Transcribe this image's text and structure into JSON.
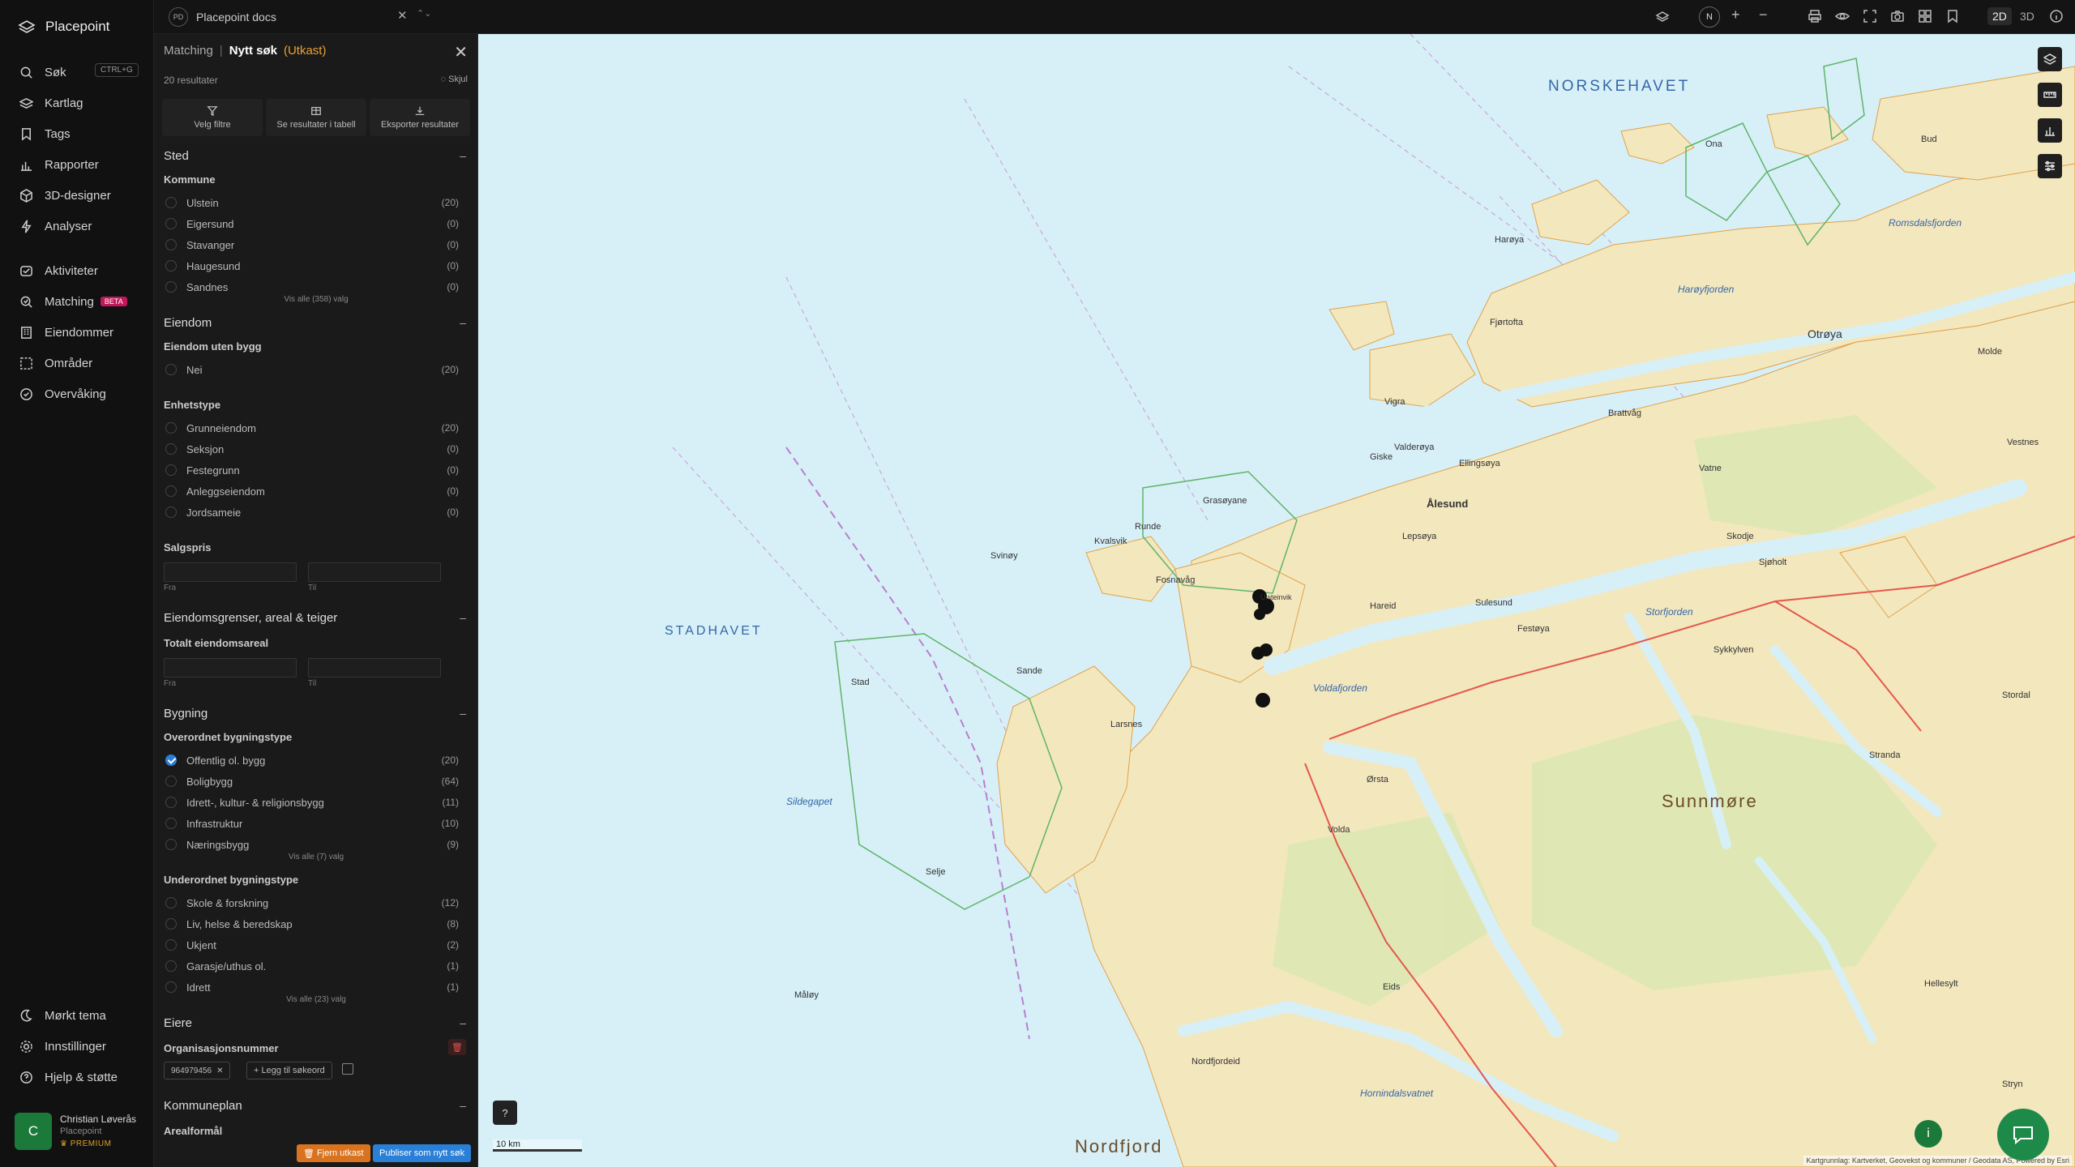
{
  "app": {
    "name": "Placepoint"
  },
  "nav": {
    "shortcut": "CTRL+G",
    "items": [
      {
        "id": "sok",
        "label": "Søk"
      },
      {
        "id": "kartlag",
        "label": "Kartlag"
      },
      {
        "id": "tags",
        "label": "Tags"
      },
      {
        "id": "rapporter",
        "label": "Rapporter"
      },
      {
        "id": "3d",
        "label": "3D-designer"
      },
      {
        "id": "analyser",
        "label": "Analyser"
      },
      {
        "id": "aktiviteter",
        "label": "Aktiviteter"
      },
      {
        "id": "matching",
        "label": "Matching",
        "badge": "BETA"
      },
      {
        "id": "eiendommer",
        "label": "Eiendommer"
      },
      {
        "id": "omrader",
        "label": "Områder"
      },
      {
        "id": "overvaking",
        "label": "Overvåking"
      }
    ],
    "bottom": [
      {
        "id": "tema",
        "label": "Mørkt tema"
      },
      {
        "id": "innst",
        "label": "Innstillinger"
      },
      {
        "id": "hjelp",
        "label": "Hjelp & støtte"
      }
    ],
    "user": {
      "initial": "C",
      "name": "Christian Løverås",
      "org": "Placepoint",
      "plan": "PREMIUM"
    }
  },
  "topbar": {
    "project_badge": "PD",
    "project": "Placepoint docs",
    "north": "N",
    "mode_2d": "2D",
    "mode_3d": "3D"
  },
  "panel": {
    "crumb": "Matching",
    "separator": "|",
    "title": "Nytt søk",
    "status": "(Utkast)",
    "result_count": "20 resultater",
    "hide_label": "Skjul",
    "actions": {
      "filter": "Velg filtre",
      "table": "Se resultater i tabell",
      "export": "Eksporter resultater"
    },
    "sted": {
      "title": "Sted",
      "kommune_title": "Kommune",
      "kommune": [
        {
          "label": "Ulstein",
          "count": "(20)"
        },
        {
          "label": "Eigersund",
          "count": "(0)"
        },
        {
          "label": "Stavanger",
          "count": "(0)"
        },
        {
          "label": "Haugesund",
          "count": "(0)"
        },
        {
          "label": "Sandnes",
          "count": "(0)"
        }
      ],
      "more": "Vis alle (358) valg"
    },
    "eiendom": {
      "title": "Eiendom",
      "uten_bygg_title": "Eiendom uten bygg",
      "uten_bygg": [
        {
          "label": "Nei",
          "count": "(20)"
        }
      ],
      "enhetstype_title": "Enhetstype",
      "enhetstype": [
        {
          "label": "Grunneiendom",
          "count": "(20)"
        },
        {
          "label": "Seksjon",
          "count": "(0)"
        },
        {
          "label": "Festegrunn",
          "count": "(0)"
        },
        {
          "label": "Anleggseiendom",
          "count": "(0)"
        },
        {
          "label": "Jordsameie",
          "count": "(0)"
        }
      ],
      "salgspris_title": "Salgspris",
      "from": "Fra",
      "to": "Til"
    },
    "grenser": {
      "title": "Eiendomsgrenser, areal & teiger",
      "areal_title": "Totalt eiendomsareal",
      "from": "Fra",
      "to": "Til"
    },
    "bygning": {
      "title": "Bygning",
      "over_title": "Overordnet bygningstype",
      "over": [
        {
          "label": "Offentlig ol. bygg",
          "count": "(20)"
        },
        {
          "label": "Boligbygg",
          "count": "(64)"
        },
        {
          "label": "Idrett-, kultur- & religionsbygg",
          "count": "(11)"
        },
        {
          "label": "Infrastruktur",
          "count": "(10)"
        },
        {
          "label": "Næringsbygg",
          "count": "(9)"
        }
      ],
      "over_more": "Vis alle (7) valg",
      "under_title": "Underordnet bygningstype",
      "under": [
        {
          "label": "Skole & forskning",
          "count": "(12)"
        },
        {
          "label": "Liv, helse & beredskap",
          "count": "(8)"
        },
        {
          "label": "Ukjent",
          "count": "(2)"
        },
        {
          "label": "Garasje/uthus ol.",
          "count": "(1)"
        },
        {
          "label": "Idrett",
          "count": "(1)"
        }
      ],
      "under_more": "Vis alle (23) valg"
    },
    "eiere": {
      "title": "Eiere",
      "org_title": "Organisasjonsnummer",
      "chip": "964979456",
      "add": "Legg til søkeord"
    },
    "kommuneplan": {
      "title": "Kommuneplan",
      "areal_title": "Arealformål"
    },
    "footer": {
      "remove": "Fjern utkast",
      "publish": "Publiser som nytt søk"
    }
  },
  "map": {
    "scale": "10 km",
    "attribution": "Kartgrunnlag: Kartverket, Geovekst og kommuner / Geodata AS, Powered by Esri",
    "labels": {
      "norskehavet": "NORSKEHAVET",
      "stadhavet": "STADHAVET",
      "sunnmore": "Sunnmøre",
      "nordfjord": "Nordfjord",
      "otrøya": "Otrøya",
      "alesund": "Ålesund",
      "hareid": "Hareid",
      "ulstein": "Ulsteinvik",
      "fosnavag": "Fosnavåg",
      "runde": "Runde",
      "sande": "Sande",
      "larsnes": "Larsnes",
      "volda": "Volda",
      "orsta": "Ørsta",
      "stranda": "Stranda",
      "sykkylven": "Sykkylven",
      "vigra": "Vigra",
      "giske": "Giske",
      "valderoya": "Valderøya",
      "ellingsoya": "Ellingsøya",
      "skodje": "Skodje",
      "sjøholt": "Sjøholt",
      "vatne": "Vatne",
      "brattvag": "Brattvåg",
      "harøya": "Harøya",
      "fjørtofta": "Fjørtofta",
      "lepsøya": "Lepsøya",
      "sulesund": "Sulesund",
      "festøya": "Festøya",
      "grasøyane": "Grasøyane",
      "svinøy": "Svinøy",
      "kvalsvik": "Kvalsvik",
      "stad": "Stad",
      "selje": "Selje",
      "eids": "Eids",
      "hornindalsvatnet": "Hornindalsvatnet",
      "storfjorden": "Storfjorden",
      "voldafjorden": "Voldafjorden",
      "romsdalsfjorden": "Romsdalsfjorden",
      "harøyfjorden": "Harøyfjorden",
      "sildegapet": "Sildegapet",
      "vestnes": "Vestnes",
      "molde": "Molde",
      "bud": "Bud",
      "ona": "Ona",
      "stordal": "Stordal",
      "hellesylt": "Hellesylt",
      "stryn": "Stryn",
      "nordfjordeid": "Nordfjordeid",
      "mauøy": "Måløy"
    }
  }
}
